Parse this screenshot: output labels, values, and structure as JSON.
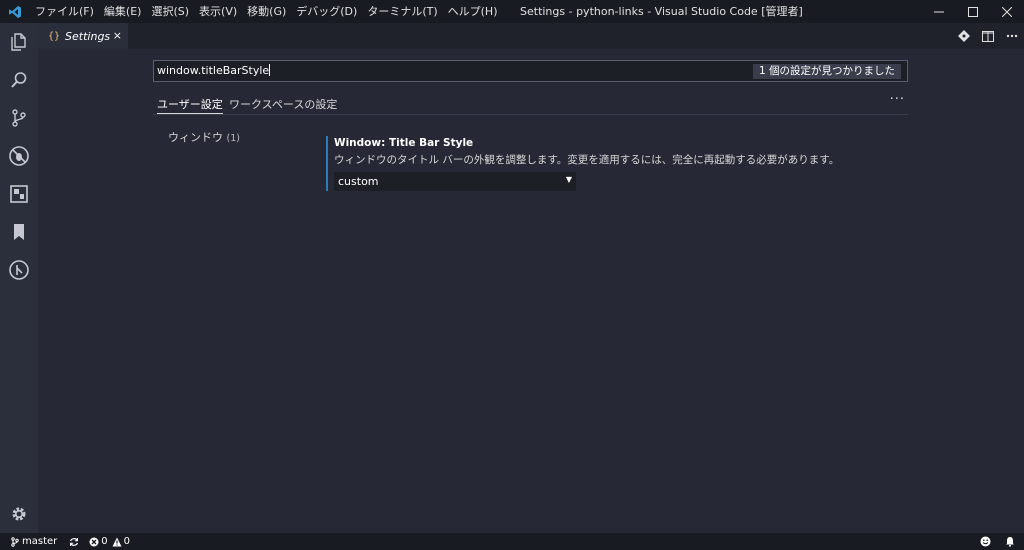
{
  "titlebar": {
    "app_icon": "vscode-logo-icon",
    "menus": [
      "ファイル(F)",
      "編集(E)",
      "選択(S)",
      "表示(V)",
      "移動(G)",
      "デバッグ(D)",
      "ターミナル(T)",
      "ヘルプ(H)"
    ],
    "window_title": "Settings - python-links - Visual Studio Code [管理者]",
    "controls": [
      "minimize-icon",
      "maximize-icon",
      "close-icon"
    ]
  },
  "activitybar": {
    "items": [
      "explorer-icon",
      "search-icon",
      "source-control-icon",
      "debug-icon",
      "extensions-icon",
      "bookmarks-icon",
      "git-history-icon"
    ],
    "bottom": "settings-gear-icon"
  },
  "tabs": [
    {
      "label": "Settings",
      "icon": "{}",
      "close": "×"
    }
  ],
  "editor_actions": [
    "open-changes-icon",
    "split-editor-icon",
    "more-actions-icon"
  ],
  "settings": {
    "search_value": "window.titleBarStyle",
    "result_count": "1 個の設定が見つかりました",
    "scope_tabs": [
      "ユーザー設定",
      "ワークスペースの設定"
    ],
    "more": "···",
    "toc": {
      "label": "ウィンドウ",
      "count": "(1)"
    },
    "item": {
      "title": "Window: Title Bar Style",
      "description": "ウィンドウのタイトル バーの外観を調整します。変更を適用するには、完全に再起動する必要があります。",
      "value": "custom",
      "arrow": "▼"
    }
  },
  "statusbar": {
    "branch": "master",
    "errors": "0",
    "warnings": "0",
    "right_icons": [
      "feedback-smiley-icon",
      "notifications-bell-icon"
    ]
  },
  "colors": {
    "accent": "#2b7bb9",
    "editor_bg": "#262935",
    "activitybar_bg": "#2b2e3b",
    "titlebar_bg": "#191b22"
  }
}
